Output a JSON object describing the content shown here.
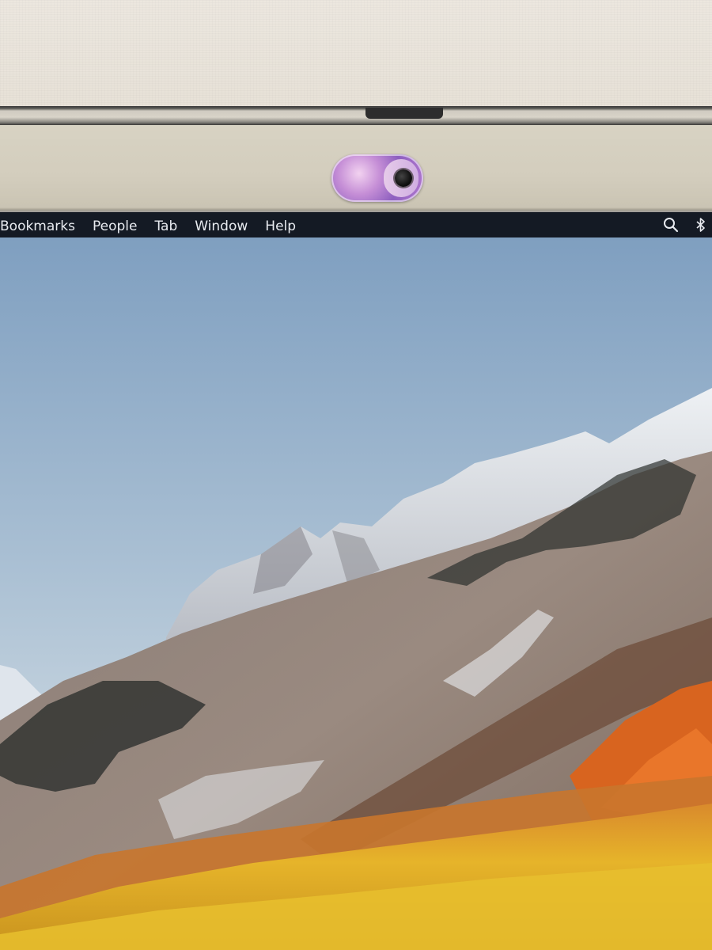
{
  "menubar": {
    "items": [
      {
        "label": "Bookmarks"
      },
      {
        "label": "People"
      },
      {
        "label": "Tab"
      },
      {
        "label": "Window"
      },
      {
        "label": "Help"
      }
    ],
    "status_icons": [
      "search-icon",
      "bluetooth-icon"
    ]
  },
  "colors": {
    "menubar_bg": "#141a24",
    "menubar_text": "#e8ebf0",
    "bezel": "#d6d0c0",
    "webcam_cover": "#b57bd0"
  },
  "desktop": {
    "wallpaper": "mountain-landscape"
  }
}
